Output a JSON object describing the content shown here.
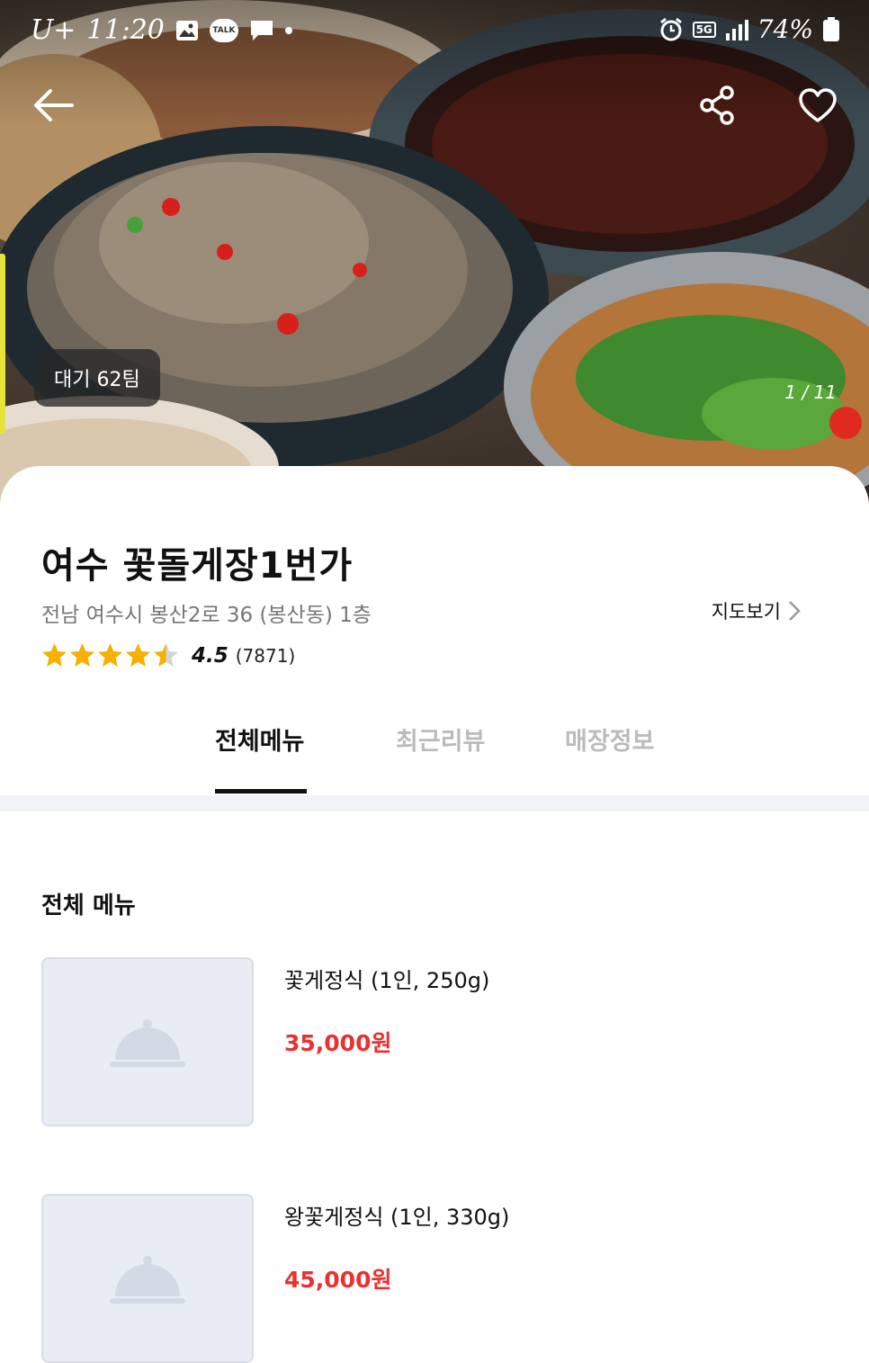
{
  "status_bar": {
    "carrier": "U+",
    "time": "11:20",
    "icons": [
      "image-icon",
      "talk-icon",
      "message-icon",
      "dot-icon"
    ],
    "talk_label": "TALK",
    "network": "5G",
    "battery": "74%"
  },
  "hero": {
    "wait_badge": "대기 62팀",
    "page_counter": "1 / 11",
    "icons": {
      "back": "back-arrow-icon",
      "share": "share-icon",
      "favorite": "heart-icon"
    }
  },
  "store": {
    "name": "여수 꽃돌게장1번가",
    "address": "전남 여수시 봉산2로 36 (봉산동) 1층",
    "map_link": "지도보기",
    "rating": 4.5,
    "rating_label": "4.5",
    "review_count": "(7871)"
  },
  "tabs": [
    {
      "label": "전체메뉴",
      "active": true
    },
    {
      "label": "최근리뷰",
      "active": false
    },
    {
      "label": "매장정보",
      "active": false
    }
  ],
  "menu": {
    "section_title": "전체 메뉴",
    "items": [
      {
        "name": "꽃게정식 (1인, 250g)",
        "price": "35,000원"
      },
      {
        "name": "왕꽃게정식 (1인, 330g)",
        "price": "45,000원"
      }
    ]
  },
  "colors": {
    "price": "#e8322f",
    "star": "#f5b000",
    "placeholder_bg": "#e8ecf4",
    "divider": "#f2f3f7"
  }
}
